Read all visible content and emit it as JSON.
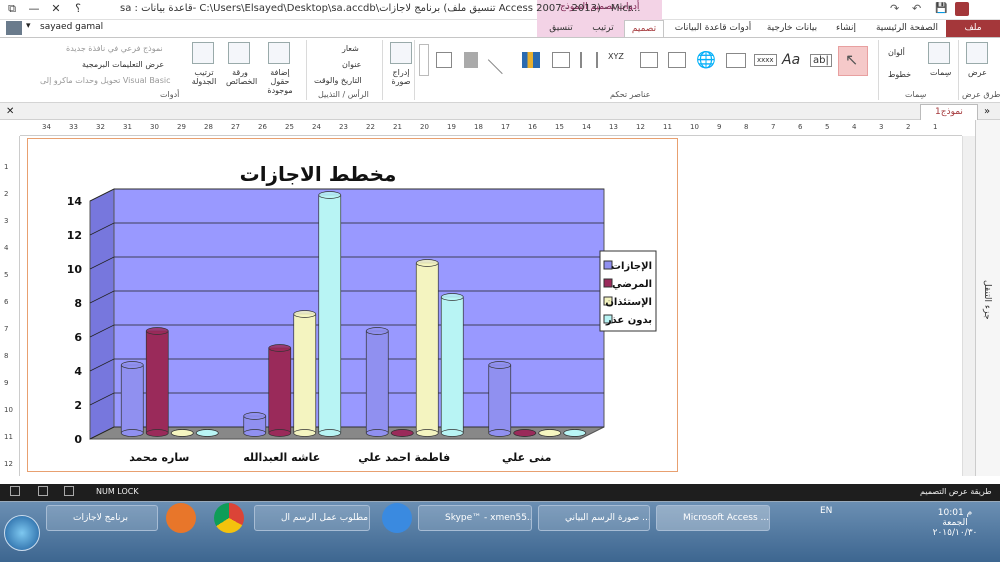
{
  "window": {
    "title": "sa : قاعدة بيانات- C:\\Users\\Elsayed\\Desktop\\sa.accdb\\برنامج لاجازات (تنسيق ملف Access 2007 - 2013) - Micr...",
    "context_group": "أدوات تصميم النموذج",
    "help": "؟",
    "user": "sayaed gamal"
  },
  "tabs": [
    "ملف",
    "الصفحة الرئيسية",
    "إنشاء",
    "بيانات خارجية",
    "أدوات قاعدة البيانات",
    "تصميم",
    "ترتيب",
    "تنسيق"
  ],
  "ribbon": {
    "views_label": "عرض",
    "views_group": "طرق عرض",
    "themes": [
      "سِمات",
      "ألوان",
      "خطوط"
    ],
    "themes_group": "سِمات",
    "controls_group": "عناصر تحكم",
    "insert_image": "إدراج صورة",
    "header": [
      "شعار",
      "عنوان",
      "التاريخ والوقت"
    ],
    "header_group": "الرأس / التذييل",
    "tools": [
      "إضافة حقول موجودة",
      "ورقة الخصائص",
      "ترتيب الجدولة"
    ],
    "tools_small": [
      "نموذج فرعي في نافذة جديدة",
      "عرض التعليمات البرمجية",
      "تحويل وحدات ماكرو إلى Visual Basic"
    ],
    "tools_group": "أدوات"
  },
  "document": {
    "tab": "نموذج1",
    "nav_pane": "جزء التنقل"
  },
  "chart_data": {
    "type": "bar",
    "title": "مخطط الاجازات",
    "categories": [
      "ساره محمد",
      "عاشه العبدالله",
      "فاطمة احمد علي",
      "منى علي"
    ],
    "series": [
      {
        "name": "الإجازات",
        "values": [
          4,
          1,
          6,
          4
        ],
        "color": "#9090f0"
      },
      {
        "name": "المرضي",
        "values": [
          6,
          5,
          0,
          0
        ],
        "color": "#9a2a5a"
      },
      {
        "name": "الإستئذان",
        "values": [
          0,
          7,
          10,
          0
        ],
        "color": "#f4f4c0"
      },
      {
        "name": "بدون عذر",
        "values": [
          0,
          14,
          8,
          0
        ],
        "color": "#b8f4f4"
      }
    ],
    "ylim": [
      0,
      14
    ],
    "yticks": [
      "0",
      "2",
      "4",
      "6",
      "8",
      "10",
      "12",
      "14"
    ],
    "plot_bg": "#9999ff",
    "grid": true,
    "legend": "right"
  },
  "status": {
    "left_text": "طريقة عرض التصميم",
    "numlock": "NUM LOCK"
  },
  "taskbar": {
    "items": [
      "برنامج لاجازات",
      "",
      "",
      "مطلوب عمل الرسم ال...",
      "",
      "Skype™ - xmen55...",
      "صورة الرسم البياني ...",
      "Microsoft Access ..."
    ],
    "lang": "EN",
    "time": "10:01 م",
    "day": "الجمعة",
    "date": "٢٠١٥/١٠/٣٠"
  }
}
